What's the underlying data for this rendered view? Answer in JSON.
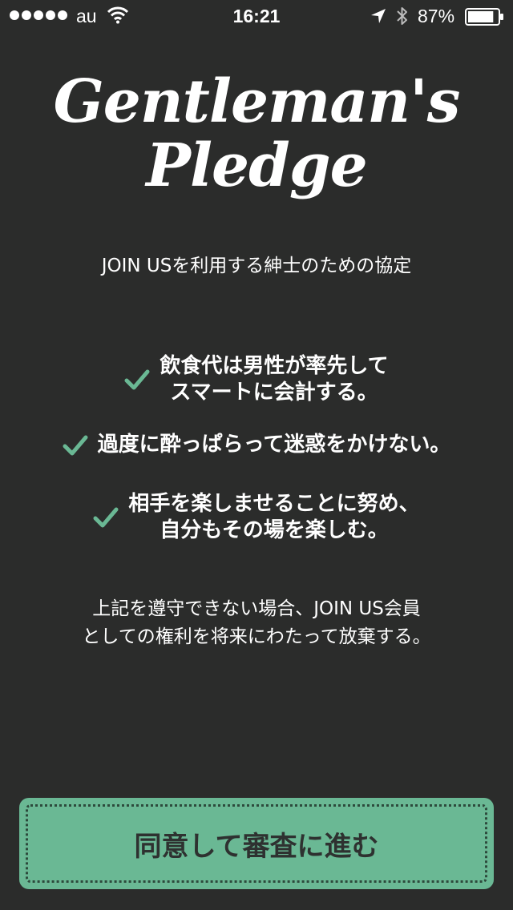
{
  "status_bar": {
    "carrier": "au",
    "time": "16:21",
    "battery_percent": "87%",
    "battery_level": 0.87,
    "signal_bars": 5,
    "icons": [
      "signal-dots-icon",
      "wifi-icon",
      "location-arrow-icon",
      "bluetooth-icon",
      "battery-icon"
    ]
  },
  "header": {
    "title_line1": "Gentleman's",
    "title_line2": "Pledge",
    "subtitle": "JOIN USを利用する紳士のための協定"
  },
  "pledges": [
    {
      "lines": [
        "飲食代は男性が率先して",
        "スマートに会計する。"
      ]
    },
    {
      "lines": [
        "過度に酔っぱらって迷惑をかけない。"
      ]
    },
    {
      "lines": [
        "相手を楽しませることに努め、",
        "自分もその場を楽しむ。"
      ]
    }
  ],
  "forfeit": {
    "line1": "上記を遵守できない場合、JOIN US会員",
    "line2": "としての権利を将来にわたって放棄する。"
  },
  "agree_button": {
    "label": "同意して審査に進む"
  },
  "colors": {
    "background": "#2b2c2b",
    "text": "#ffffff",
    "check_accent": "#6ab894",
    "button_bg": "#6ab894",
    "button_text": "#2e3130"
  }
}
